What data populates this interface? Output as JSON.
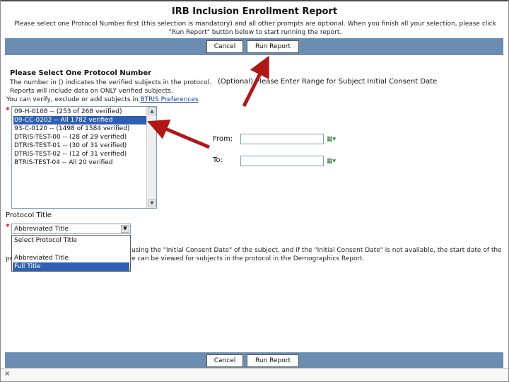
{
  "header": {
    "title": "IRB Inclusion Enrollment Report",
    "instructions": "Please select one Protocol Number first (this selection is mandatory) and all other prompts are optional. When you finish all your selection, please click \"Run Report\" button below to start running the report."
  },
  "toolbar": {
    "cancel_label": "Cancel",
    "run_label": "Run Report"
  },
  "protocol": {
    "heading": "Please Select One Protocol Number",
    "note_line1": "The number in () indicates the verified subjects in the protocol.",
    "note_line2": "Reports will include data on ONLY verified subjects.",
    "note_line3_prefix": "You can verify, exclude or add subjects in ",
    "note_line3_link": "BTRIS Preferences",
    "required_mark": "*",
    "items": [
      "09-H-0108 -- (253 of 268 verified)",
      "09-CC-0202 -- All 1782 verified",
      "93-C-0120 -- (1498 of 1584 verified)",
      "DTRIS-TEST-00 -- (28 of 29 verified)",
      "DTRIS-TEST-01 -- (30 of 31 verified)",
      "DTRIS-TEST-02 -- (12 of 31 verified)",
      "BTRIS-TEST-04 -- All 20 verified"
    ],
    "selected_index": 1,
    "scroll_up": "▲",
    "scroll_down": "▼"
  },
  "consent": {
    "heading": "(Optional) Please Enter Range for Subject Initial Consent Date",
    "from_label": "From:",
    "to_label": "To:",
    "from_value": "",
    "to_value": "",
    "calendar_glyph": "▦▾"
  },
  "title_select": {
    "label": "Protocol Title",
    "required_mark": "*",
    "value": "Abbreviated Title",
    "arrow": "▼",
    "options": [
      "Select Protocol Title",
      "",
      "Abbreviated Title",
      "Full Title"
    ],
    "highlighted_index": 3
  },
  "notes": {
    "line1": "using the \"Initial Consent Date\" of the subject, and if the \"Initial Consent Date\" is not available, the start date of the",
    "line1_prefix": "pr",
    "line2": "e can be viewed for subjects in the protocol in the Demographics Report."
  },
  "status": {
    "close_glyph": "×"
  },
  "colors": {
    "bar": "#6c8db2",
    "selection": "#2f5fb2",
    "required": "#d01010",
    "link": "#1a3fa8",
    "arrow": "#b01818"
  }
}
